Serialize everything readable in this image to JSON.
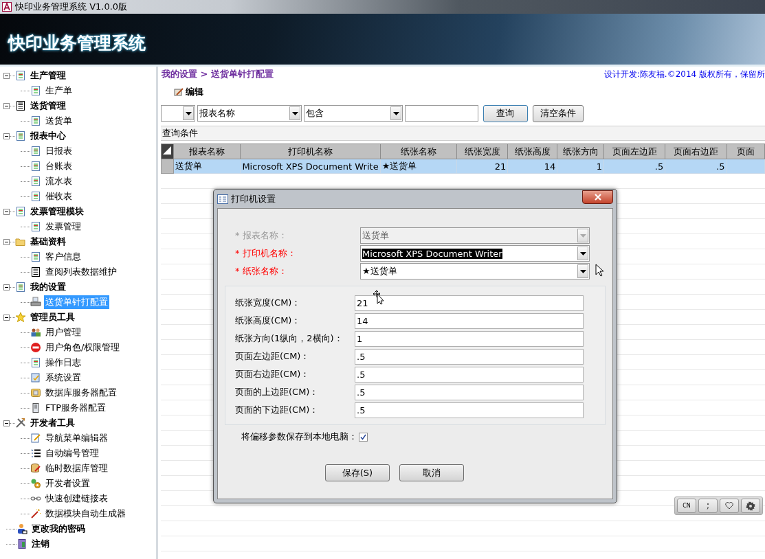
{
  "window": {
    "title": "快印业务管理系统 V1.0.0版"
  },
  "banner": {
    "title": "快印业务管理系统"
  },
  "sidebar": {
    "items": [
      {
        "label": "生产管理",
        "kind": "doc",
        "expanded": true,
        "children": [
          {
            "label": "生产单",
            "kind": "doc",
            "selected": false
          }
        ]
      },
      {
        "label": "送货管理",
        "kind": "list",
        "expanded": true,
        "children": [
          {
            "label": "送货单",
            "kind": "doc",
            "selected": false
          }
        ]
      },
      {
        "label": "报表中心",
        "kind": "doc",
        "expanded": true,
        "children": [
          {
            "label": "日报表",
            "kind": "doc",
            "selected": false
          },
          {
            "label": "台账表",
            "kind": "doc",
            "selected": false
          },
          {
            "label": "流水表",
            "kind": "doc",
            "selected": false
          },
          {
            "label": "催收表",
            "kind": "doc",
            "selected": false
          }
        ]
      },
      {
        "label": "发票管理模块",
        "kind": "doc",
        "expanded": true,
        "children": [
          {
            "label": "发票管理",
            "kind": "doc",
            "selected": false
          }
        ]
      },
      {
        "label": "基础资料",
        "kind": "folder",
        "expanded": true,
        "children": [
          {
            "label": "客户信息",
            "kind": "doc",
            "selected": false
          },
          {
            "label": "查阅列表数据维护",
            "kind": "list",
            "selected": false
          }
        ]
      },
      {
        "label": "我的设置",
        "kind": "doc",
        "expanded": true,
        "children": [
          {
            "label": "送货单针打配置",
            "kind": "printer",
            "selected": true
          }
        ]
      },
      {
        "label": "管理员工具",
        "kind": "star",
        "expanded": true,
        "children": [
          {
            "label": "用户管理",
            "kind": "users",
            "selected": false
          },
          {
            "label": "用户角色/权限管理",
            "kind": "stop",
            "selected": false
          },
          {
            "label": "操作日志",
            "kind": "doc",
            "selected": false
          },
          {
            "label": "系统设置",
            "kind": "settings",
            "selected": false
          },
          {
            "label": "数据库服务器配置",
            "kind": "database",
            "selected": false
          },
          {
            "label": "FTP服务器配置",
            "kind": "server",
            "selected": false
          }
        ]
      },
      {
        "label": "开发者工具",
        "kind": "tools",
        "expanded": true,
        "children": [
          {
            "label": "导航菜单编辑器",
            "kind": "edit",
            "selected": false
          },
          {
            "label": "自动编号管理",
            "kind": "numbered",
            "selected": false
          },
          {
            "label": "临时数据库管理",
            "kind": "dbedit",
            "selected": false
          },
          {
            "label": "开发者设置",
            "kind": "gear",
            "selected": false
          },
          {
            "label": "快速创建链接表",
            "kind": "link",
            "selected": false
          },
          {
            "label": "数据模块自动生成器",
            "kind": "wand",
            "selected": false
          }
        ]
      },
      {
        "label": "更改我的密码",
        "kind": "user"
      },
      {
        "label": "注销",
        "kind": "door"
      }
    ]
  },
  "breadcrumb": "我的设置 > 送货单针打配置",
  "credit": "设计开发:陈友福.©2014 版权所有，保留所",
  "toolbar": {
    "edit_button": "编辑"
  },
  "filter": {
    "field": "报表名称",
    "operator": "包含",
    "search_button": "查询",
    "clear_button": "清空条件"
  },
  "query_bar": "查询条件",
  "table": {
    "columns": [
      "报表名称",
      "打印机名称",
      "纸张名称",
      "纸张宽度",
      "纸张高度",
      "纸张方向",
      "页面左边距",
      "页面右边距",
      "页面"
    ],
    "rows": [
      {
        "selected": true,
        "cells": [
          "送货单",
          "Microsoft XPS Document Write",
          "★送货单",
          "21",
          "14",
          "1",
          ".5",
          ".5",
          ""
        ]
      }
    ]
  },
  "dialog": {
    "title": "打印机设置",
    "selects": [
      {
        "label": "* 报表名称：",
        "value": "送货单",
        "disabled": true,
        "highlighted": false
      },
      {
        "label": "* 打印机名称：",
        "value": "Microsoft XPS Document Writer",
        "disabled": false,
        "highlighted": true
      },
      {
        "label": "* 纸张名称：",
        "value": "★送货单",
        "disabled": false,
        "highlighted": false
      }
    ],
    "fields": [
      {
        "label": "纸张宽度(CM)：",
        "value": "21"
      },
      {
        "label": "纸张高度(CM)：",
        "value": "14"
      },
      {
        "label": "纸张方向(1纵向，2横向)：",
        "value": "1"
      },
      {
        "label": "页面左边距(CM)：",
        "value": ".5"
      },
      {
        "label": "页面右边距(CM)：",
        "value": ".5"
      },
      {
        "label": "页面的上边距(CM)：",
        "value": ".5"
      },
      {
        "label": "页面的下边距(CM)：",
        "value": ".5"
      }
    ],
    "save_local": {
      "label": "将偏移参数保存到本地电脑：",
      "checked": true
    },
    "buttons": [
      "保存(S)",
      "取消"
    ]
  },
  "ime_bar": {
    "mode": "CN"
  }
}
